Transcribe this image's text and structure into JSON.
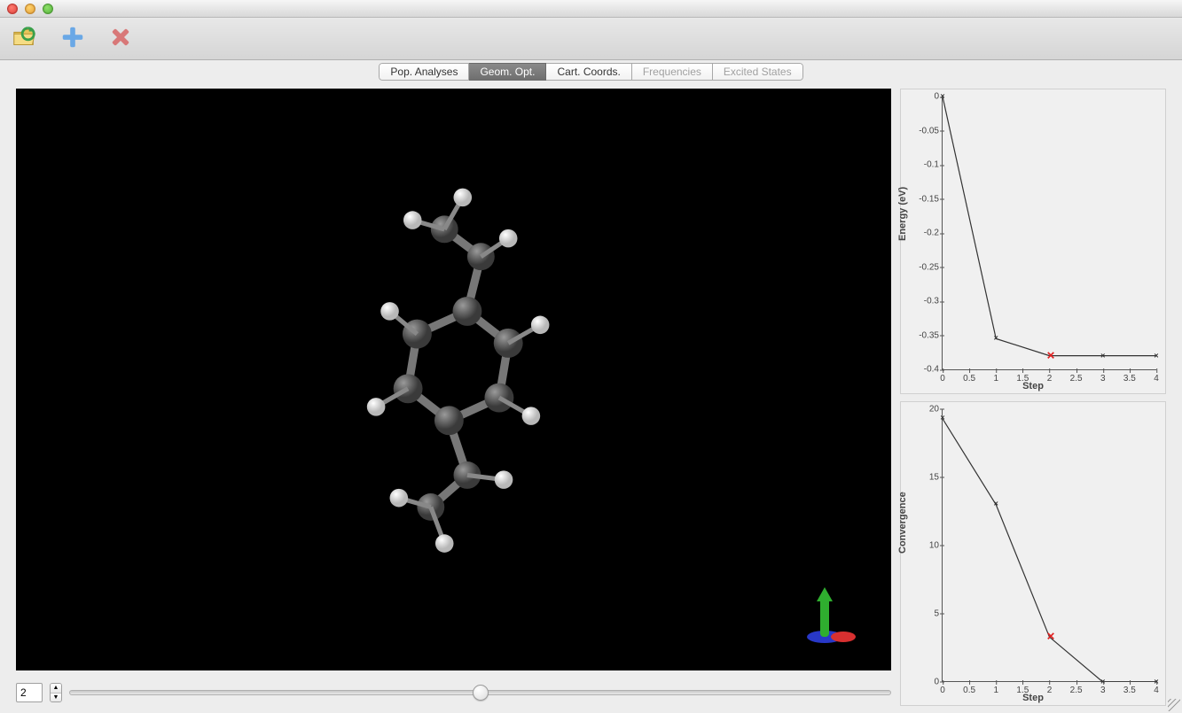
{
  "window": {
    "title": ""
  },
  "toolbar": {
    "icons": [
      "open-folder-icon",
      "add-icon",
      "remove-icon"
    ]
  },
  "tabs": {
    "items": [
      {
        "label": "Pop. Analyses",
        "state": "enabled"
      },
      {
        "label": "Geom. Opt.",
        "state": "selected"
      },
      {
        "label": "Cart. Coords.",
        "state": "enabled"
      },
      {
        "label": "Frequencies",
        "state": "disabled"
      },
      {
        "label": "Excited States",
        "state": "disabled"
      }
    ]
  },
  "viewer": {
    "axes": {
      "x_color": "#d83030",
      "y_color": "#30c030",
      "z_color": "#3040d8"
    }
  },
  "step_control": {
    "value": "2",
    "min": 0,
    "max": 4,
    "slider_position_percent": 50
  },
  "chart_data": [
    {
      "type": "line",
      "title": "",
      "ylabel": "Energy (eV)",
      "xlabel": "Step",
      "x": [
        0,
        1,
        2,
        3,
        4
      ],
      "y": [
        0.0,
        -0.355,
        -0.38,
        -0.38,
        -0.38
      ],
      "xlim": [
        0,
        4
      ],
      "ylim": [
        -0.4,
        0.0
      ],
      "xticks": [
        0,
        0.5,
        1,
        1.5,
        2,
        2.5,
        3,
        3.5,
        4
      ],
      "yticks": [
        0,
        -0.05,
        -0.1,
        -0.15,
        -0.2,
        -0.25,
        -0.3,
        -0.35,
        -0.4
      ],
      "highlight_index": 2,
      "highlight_color": "#e02020"
    },
    {
      "type": "line",
      "title": "",
      "ylabel": "Convergence",
      "xlabel": "Step",
      "x": [
        0,
        1,
        2,
        3,
        4
      ],
      "y": [
        19.3,
        13.0,
        3.3,
        0.0,
        0.0
      ],
      "xlim": [
        0,
        4
      ],
      "ylim": [
        0,
        20
      ],
      "xticks": [
        0,
        0.5,
        1,
        1.5,
        2,
        2.5,
        3,
        3.5,
        4
      ],
      "yticks": [
        0,
        5,
        10,
        15,
        20
      ],
      "highlight_index": 2,
      "highlight_color": "#e02020"
    }
  ]
}
